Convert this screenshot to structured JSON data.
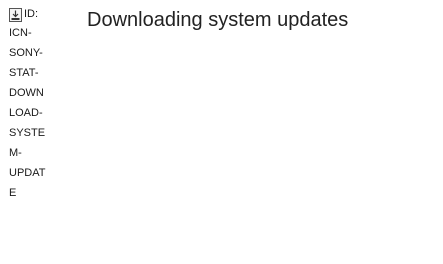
{
  "icon": {
    "name": "download-icon",
    "id_lines": [
      "ID:",
      "ICN-",
      "SONY-",
      "STAT-",
      "DOWN",
      "LOAD-",
      "SYSTE",
      "M-",
      "UPDAT",
      "E"
    ]
  },
  "status": {
    "text": "Downloading system updates"
  }
}
